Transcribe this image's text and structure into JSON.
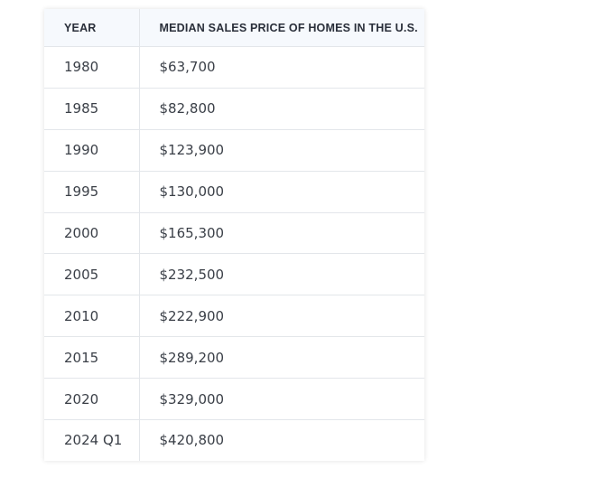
{
  "table": {
    "headers": {
      "year": "YEAR",
      "price": "MEDIAN SALES PRICE OF HOMES IN THE U.S."
    },
    "rows": [
      {
        "year": "1980",
        "price": "$63,700"
      },
      {
        "year": "1985",
        "price": "$82,800"
      },
      {
        "year": "1990",
        "price": "$123,900"
      },
      {
        "year": "1995",
        "price": "$130,000"
      },
      {
        "year": "2000",
        "price": "$165,300"
      },
      {
        "year": "2005",
        "price": "$232,500"
      },
      {
        "year": "2010",
        "price": "$222,900"
      },
      {
        "year": "2015",
        "price": "$289,200"
      },
      {
        "year": "2020",
        "price": "$329,000"
      },
      {
        "year": "2024 Q1",
        "price": "$420,800"
      }
    ]
  },
  "colors": {
    "header_background": "#f6f9fd",
    "border": "#e3e6ea",
    "text": "#3a3f47",
    "header_text": "#2a2f3a"
  }
}
